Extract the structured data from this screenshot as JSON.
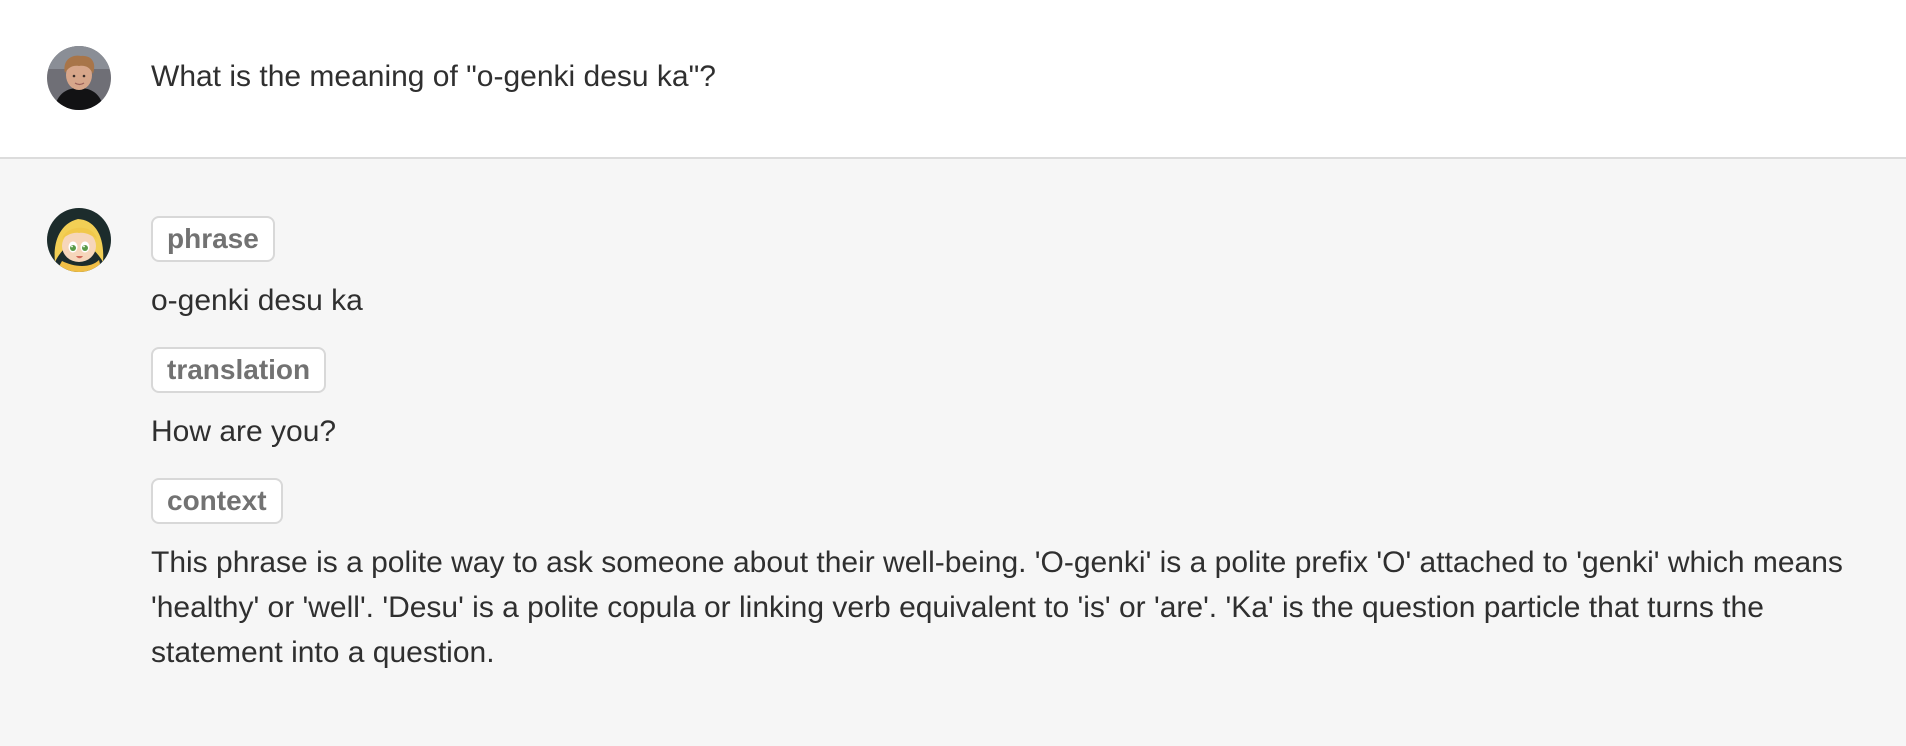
{
  "user": {
    "avatar_icon": "user-avatar-icon",
    "message": "What is the meaning of \"o-genki desu ka\"?"
  },
  "assistant": {
    "avatar_icon": "assistant-avatar-icon",
    "sections": [
      {
        "label": "phrase",
        "value": "o-genki desu ka"
      },
      {
        "label": "translation",
        "value": "How are you?"
      },
      {
        "label": "context",
        "value": "This phrase is a polite way to ask someone about their well-being. 'O-genki' is a polite prefix 'O' attached to 'genki' which means 'healthy' or 'well'. 'Desu' is a polite copula or linking verb equivalent to 'is' or 'are'. 'Ka' is the question particle that turns the statement into a question."
      }
    ]
  }
}
